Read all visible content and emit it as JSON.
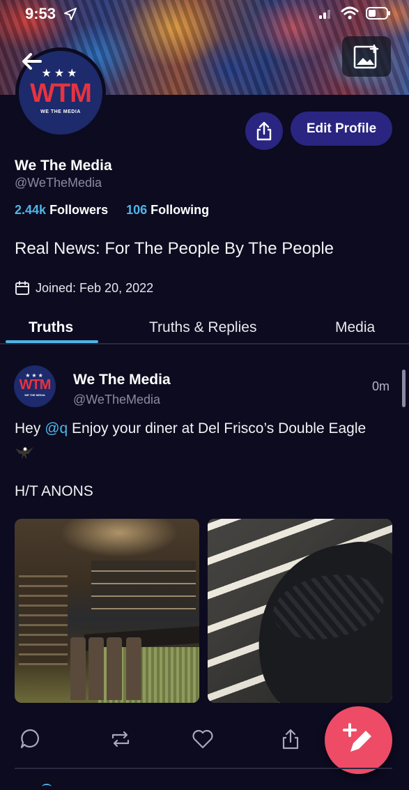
{
  "status_bar": {
    "time": "9:53"
  },
  "profile": {
    "avatar_stars": "★★★",
    "avatar_mark": "WTM",
    "avatar_subtitle": "WE THE MEDIA",
    "edit_profile_label": "Edit Profile",
    "display_name": "We The Media",
    "handle": "@WeTheMedia",
    "followers_count": "2.44k",
    "followers_label": "Followers",
    "following_count": "106",
    "following_label": "Following",
    "bio": "Real News: For The People By The People",
    "joined": "Joined: Feb 20, 2022"
  },
  "tabs": [
    {
      "label": "Truths",
      "active": true
    },
    {
      "label": "Truths & Replies",
      "active": false
    },
    {
      "label": "Media",
      "active": false
    }
  ],
  "post": {
    "avatar_stars": "★★★",
    "avatar_mark": "WTM",
    "avatar_subtitle": "WE THE MEDIA",
    "author_name": "We The Media",
    "author_handle": "@WeTheMedia",
    "time": "0m",
    "text_prefix": "Hey ",
    "mention": "@q",
    "text_suffix": " Enjoy your diner at Del Frisco’s Double Eagle",
    "text_line2": "H/T ANONS"
  },
  "colors": {
    "background": "#0c0b1f",
    "accent_blue": "#4fb6e8",
    "button_purple": "#2a2580",
    "fab_pink": "#ee4b67",
    "logo_red": "#e8333f"
  },
  "icons": {
    "back": "arrow-left-icon",
    "banner_edit": "image-add-icon",
    "share": "share-icon",
    "calendar": "calendar-icon",
    "reply": "comment-icon",
    "retruth": "repost-icon",
    "like": "heart-icon",
    "post_share": "share-icon",
    "compose": "pencil-plus-icon"
  }
}
